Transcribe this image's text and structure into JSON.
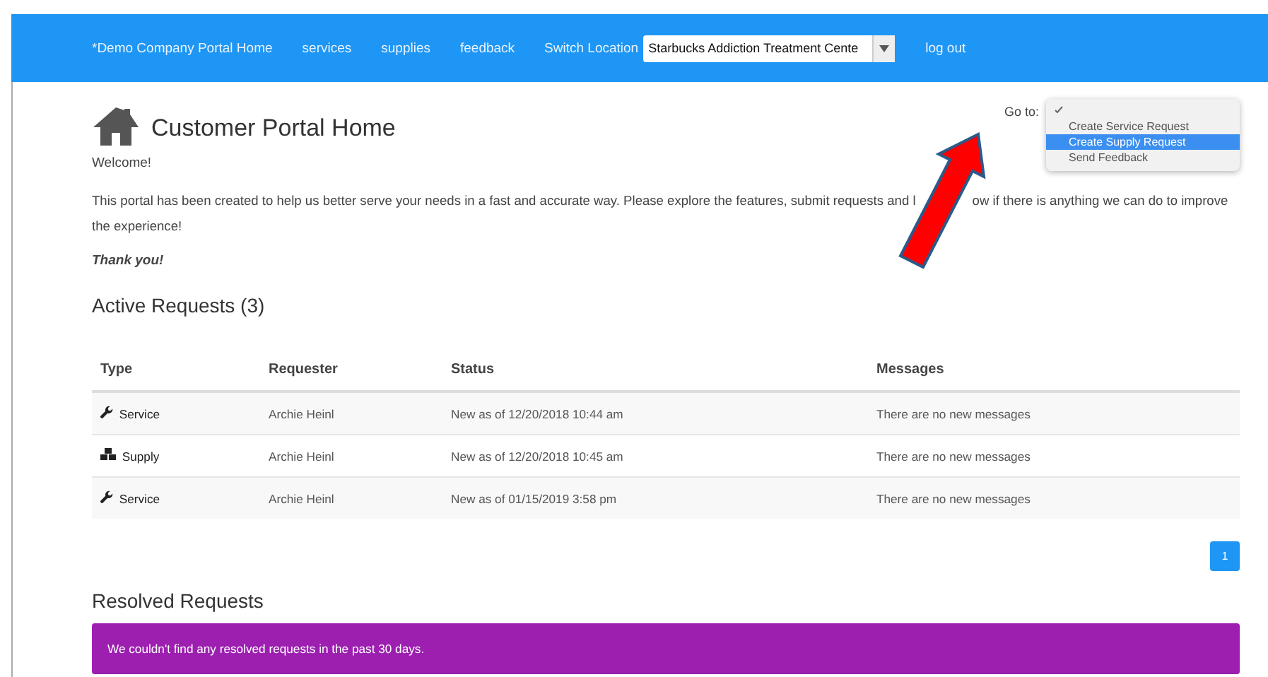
{
  "navbar": {
    "links": [
      {
        "label": "*Demo Company Portal Home"
      },
      {
        "label": "services"
      },
      {
        "label": "supplies"
      },
      {
        "label": "feedback"
      }
    ],
    "location_label": "Switch Location",
    "location_value": "Starbucks Addiction Treatment Cente",
    "logout": "log out"
  },
  "header": {
    "title": "Customer Portal Home",
    "goto_label": "Go to:"
  },
  "goto_menu": {
    "blank_option_checked": true,
    "options": [
      {
        "label": "Create Service Request",
        "selected": false
      },
      {
        "label": "Create Supply Request",
        "selected": true
      },
      {
        "label": "Send Feedback",
        "selected": false
      }
    ]
  },
  "welcome": "Welcome!",
  "intro": {
    "before_arrow": "This portal has been created to help us better serve your needs in a fast and accurate way. Please explore the features, submit requests and l",
    "after_arrow": "ow if there is anything we can do to improve",
    "next_line": "the experience!"
  },
  "thanks": "Thank you!",
  "active": {
    "title": "Active Requests (3)",
    "columns": [
      "Type",
      "Requester",
      "Status",
      "Messages"
    ],
    "rows": [
      {
        "kind": "service",
        "type": "Service",
        "requester": "Archie Heinl",
        "status": "New as of 12/20/2018 10:44 am",
        "messages": "There are no new messages"
      },
      {
        "kind": "supply",
        "type": "Supply",
        "requester": "Archie Heinl",
        "status": "New as of 12/20/2018 10:45 am",
        "messages": "There are no new messages"
      },
      {
        "kind": "service",
        "type": "Service",
        "requester": "Archie Heinl",
        "status": "New as of 01/15/2019 3:58 pm",
        "messages": "There are no new messages"
      }
    ],
    "pages": [
      {
        "label": "1",
        "selected": true
      }
    ]
  },
  "resolved": {
    "title": "Resolved Requests",
    "notice": "We couldn't find any resolved requests in the past 30 days."
  }
}
